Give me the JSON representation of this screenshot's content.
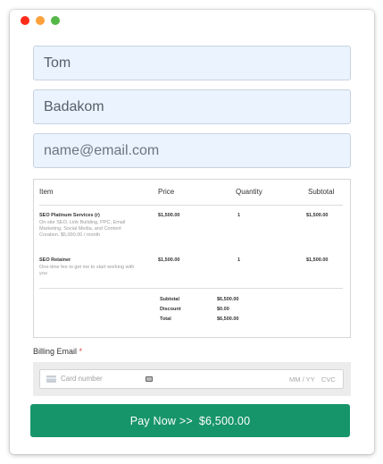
{
  "window": {
    "controls": [
      "close",
      "minimize",
      "maximize"
    ],
    "colors": {
      "close": "#ff2b1a",
      "minimize": "#ffa13a",
      "maximize": "#55b748"
    }
  },
  "form": {
    "first_name": {
      "value": "Tom"
    },
    "last_name": {
      "value": "Badakom"
    },
    "email": {
      "placeholder": "name@email.com"
    }
  },
  "invoice": {
    "headers": {
      "item": "Item",
      "price": "Price",
      "quantity": "Quantity",
      "subtotal": "Subtotal"
    },
    "rows": [
      {
        "name": "SEO Platinum Services (r)",
        "description": "On-site SEO, Link Building, PPC, Email Marketing, Social Media, and Content Creation. $5,000.00 / month",
        "price": "$1,500.00",
        "quantity": "1",
        "subtotal": "$1,500.00"
      },
      {
        "name": "SEO Retainer",
        "description": "One-time fee to get me to start working with you",
        "price": "$1,500.00",
        "quantity": "1",
        "subtotal": "$1,500.00"
      }
    ],
    "totals": {
      "subtotal_label": "Subtotal",
      "subtotal_value": "$6,500.00",
      "discount_label": "Discount",
      "discount_value": "$0.00",
      "total_label": "Total",
      "total_value": "$6,500.00"
    }
  },
  "billing": {
    "label": "Billing Email",
    "required_mark": "*",
    "card": {
      "number_placeholder": "Card number",
      "expiry_placeholder": "MM / YY",
      "cvc_placeholder": "CVC"
    }
  },
  "pay_button": {
    "label": "Pay  Now >>",
    "amount": "$6,500.00",
    "color": "#17956a"
  }
}
